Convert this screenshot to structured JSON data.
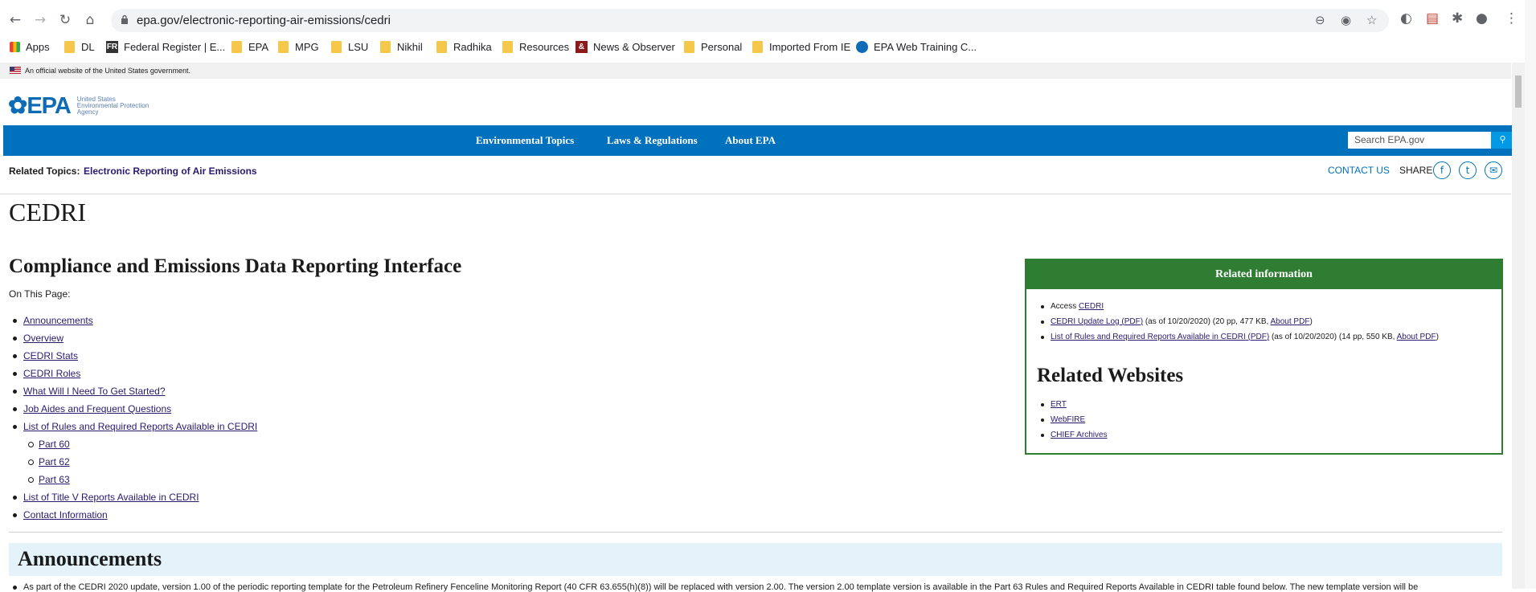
{
  "browser": {
    "url": "epa.gov/electronic-reporting-air-emissions/cedri",
    "bookmarks": [
      {
        "label": "Apps",
        "icon": "apps-grid-icon"
      },
      {
        "label": "DL",
        "icon": "folder-icon"
      },
      {
        "label": "Federal Register | E...",
        "icon": "federal-register-favicon"
      },
      {
        "label": "EPA",
        "icon": "folder-icon"
      },
      {
        "label": "MPG",
        "icon": "folder-icon"
      },
      {
        "label": "LSU",
        "icon": "folder-icon"
      },
      {
        "label": "Nikhil",
        "icon": "folder-icon"
      },
      {
        "label": "Radhika",
        "icon": "folder-icon"
      },
      {
        "label": "Resources",
        "icon": "folder-icon"
      },
      {
        "label": "News & Observer",
        "icon": "news-observer-favicon"
      },
      {
        "label": "Personal",
        "icon": "folder-icon"
      },
      {
        "label": "Imported From IE",
        "icon": "folder-icon"
      },
      {
        "label": "EPA Web Training C...",
        "icon": "epa-favicon"
      }
    ],
    "fr_badge": "FR"
  },
  "gov_banner": "An official website of the United States government.",
  "header": {
    "logo": "EPA",
    "agency_lines": [
      "United States",
      "Environmental Protection",
      "Agency"
    ]
  },
  "nav": {
    "items": [
      "Environmental Topics",
      "Laws & Regulations",
      "About EPA"
    ],
    "search_placeholder": "Search EPA.gov"
  },
  "related_bar": {
    "label": "Related Topics:",
    "link": "Electronic Reporting of Air Emissions",
    "contact": "CONTACT US",
    "share": "SHARE"
  },
  "page": {
    "title": "CEDRI",
    "subtitle": "Compliance and Emissions Data Reporting Interface",
    "on_this_page": "On This Page:",
    "toc": [
      "Announcements",
      "Overview",
      "CEDRI Stats",
      "CEDRI Roles",
      "What Will I Need To Get Started?",
      "Job Aides and Frequent Questions",
      "List of Rules and Required Reports Available in CEDRI"
    ],
    "toc_sub": [
      "Part 60",
      "Part 62",
      "Part 63"
    ],
    "toc_after": [
      "List of Title V Reports Available in CEDRI",
      "Contact Information"
    ],
    "announcements_title": "Announcements",
    "announcement_text": "As part of the CEDRI 2020 update, version 1.00 of the periodic reporting template for the Petroleum Refinery Fenceline Monitoring Report (40 CFR 63.655(h)(8)) will be replaced with version 2.00. The version 2.00 template version is available in the Part 63 Rules and Required Reports Available in CEDRI table found below. The new template version will be"
  },
  "sidebar": {
    "heading": "Related information",
    "info": [
      {
        "prefix": "Access ",
        "link": "CEDRI",
        "rest": ""
      },
      {
        "prefix": "",
        "link": "CEDRI Update Log",
        "pdf": "PDF",
        "rest": " (as of 10/20/2020) (20 pp, 477 KB, ",
        "about": "About PDF",
        "close": ")"
      },
      {
        "prefix": "",
        "link": "List of Rules and Required Reports Available in CEDRI",
        "pdf": "PDF",
        "rest": " (as of 10/20/2020) (14 pp, 550 KB, ",
        "about": "About PDF",
        "close": ")"
      }
    ],
    "websites_heading": "Related Websites",
    "websites": [
      "ERT",
      "WebFIRE",
      "CHIEF Archives"
    ]
  },
  "colors": {
    "nav_blue": "#0071bc",
    "sidebar_green": "#2e7d32",
    "visited_link": "#2b1a6e",
    "announce_bg": "#e4f2fa"
  }
}
